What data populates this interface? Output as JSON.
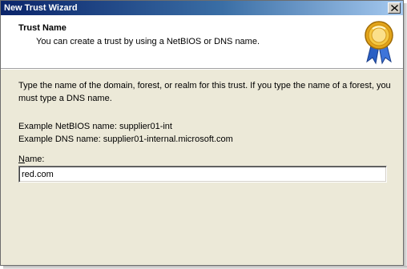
{
  "window": {
    "title": "New Trust Wizard",
    "close_icon": "close-icon"
  },
  "header": {
    "title": "Trust Name",
    "subtitle": "You can create a trust by using a NetBIOS or DNS name.",
    "badge_icon": "award-ribbon-icon"
  },
  "content": {
    "instructions": "Type the name of the domain, forest, or realm for this trust. If you type the name of a forest, you must type a DNS name.",
    "example_netbios": "Example NetBIOS name: supplier01-int",
    "example_dns": "Example DNS name: supplier01-internal.microsoft.com",
    "name_label_first": "N",
    "name_label_rest": "ame:",
    "name_value": "red.com"
  },
  "colors": {
    "title_bar_start": "#0a246a",
    "title_bar_end": "#a6caf0",
    "dialog_face": "#ece9d8"
  }
}
